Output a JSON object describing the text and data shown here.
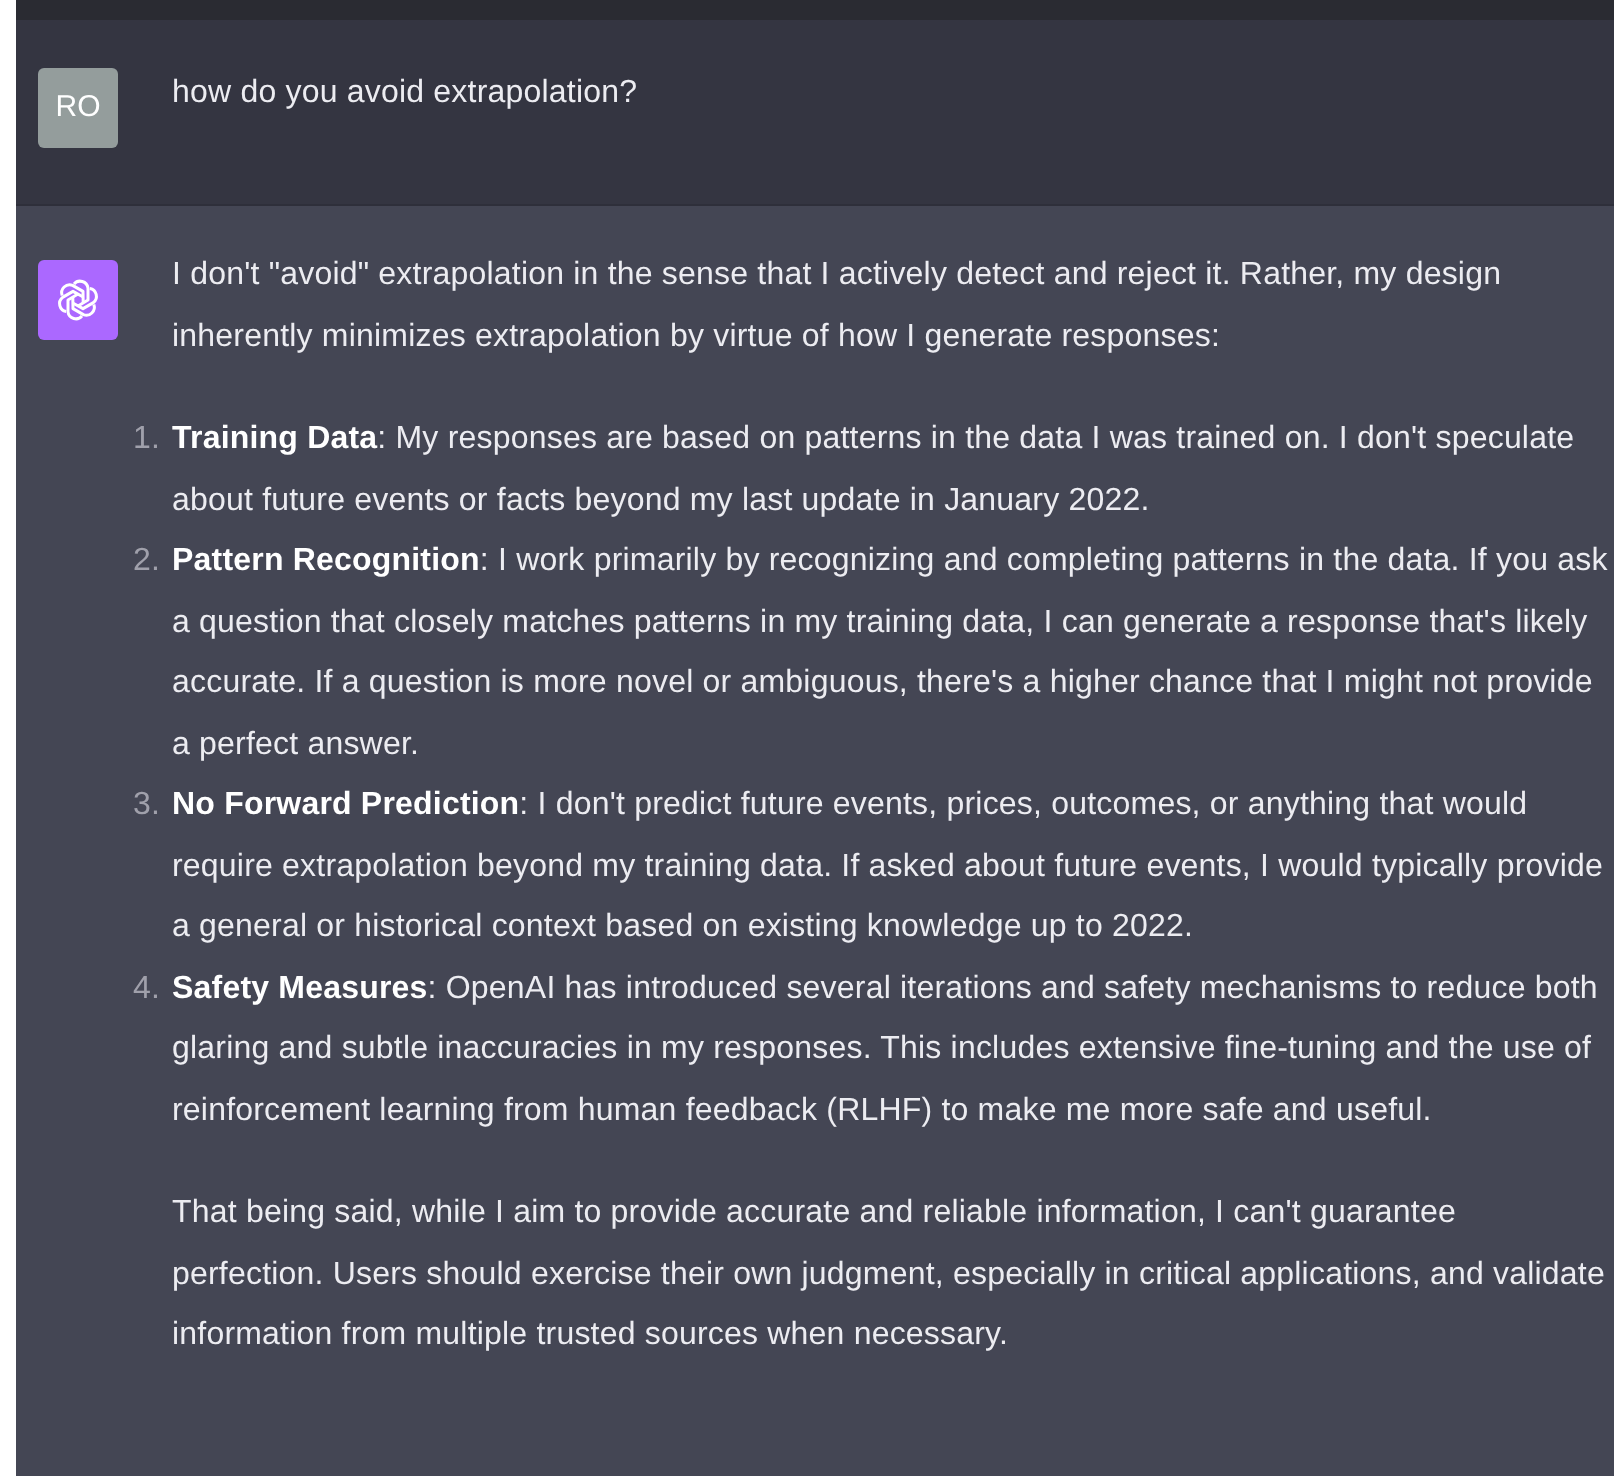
{
  "conversation": [
    {
      "kind": "user",
      "avatar": "RO",
      "text": "how do you avoid extrapolation?"
    },
    {
      "kind": "assistant",
      "intro": "I don't \"avoid\" extrapolation in the sense that I actively detect and reject it. Rather, my design inherently minimizes extrapolation by virtue of how I generate responses:",
      "list": [
        {
          "number": "1.",
          "text": "**Training Data**: My responses are based on patterns in the data I was trained on. I don't speculate about future events or facts beyond my last update in January 2022."
        },
        {
          "number": "2.",
          "text": "**Pattern Recognition**: I work primarily by recognizing and completing patterns in the data. If you ask a question that closely matches patterns in my training data, I can generate a response that's likely accurate. If a question is more novel or ambiguous, there's a higher chance that I might not provide a perfect answer."
        },
        {
          "number": "3.",
          "text": "**No Forward Prediction**: I don't predict future events, prices, outcomes, or anything that would require extrapolation beyond my training data. If asked about future events, I would typically provide a general or historical context based on existing knowledge up to 2022."
        },
        {
          "number": "4.",
          "text": "**Safety Measures**: OpenAI has introduced several iterations and safety mechanisms to reduce both glaring and subtle inaccuracies in my responses. This includes extensive fine-tuning and the use of reinforcement learning from human feedback (RLHF) to make me more safe and useful."
        }
      ],
      "outro": "That being said, while I aim to provide accurate and reliable information, I can't guarantee perfection. Users should exercise their own judgment, especially in critical applications, and validate information from multiple trusted sources when necessary."
    }
  ]
}
